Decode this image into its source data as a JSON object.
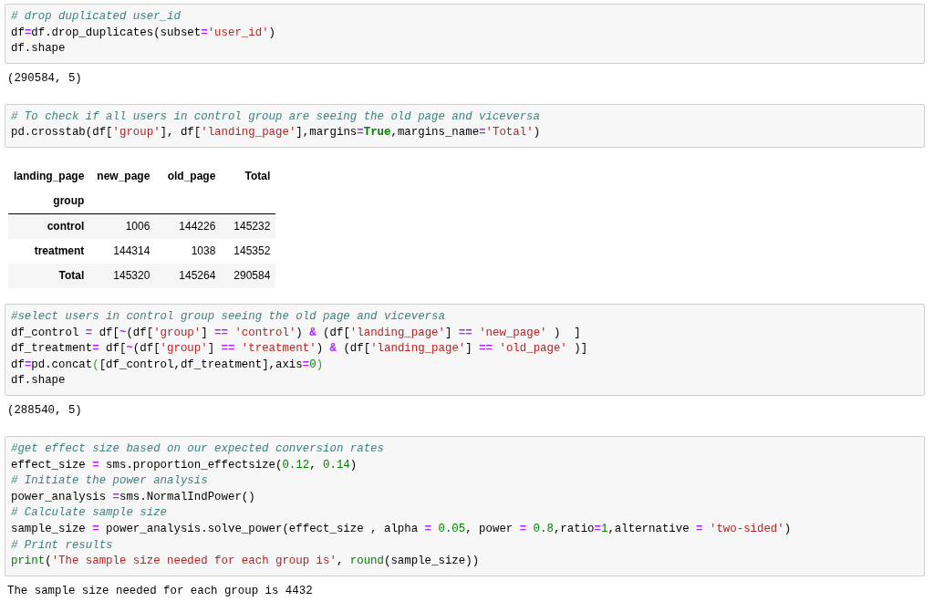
{
  "cells": [
    {
      "input": [
        [
          {
            "kind": "comment",
            "text": "# drop duplicated user_id"
          }
        ],
        [
          {
            "kind": "plain",
            "text": "df"
          },
          {
            "kind": "op",
            "text": "="
          },
          {
            "kind": "plain",
            "text": "df.drop_duplicates(subset"
          },
          {
            "kind": "op",
            "text": "="
          },
          {
            "kind": "string",
            "text": "'user_id'"
          },
          {
            "kind": "plain",
            "text": ")"
          }
        ],
        [
          {
            "kind": "plain",
            "text": "df.shape"
          }
        ]
      ],
      "output": {
        "kind": "text",
        "text": "(290584, 5)"
      }
    },
    {
      "input": [
        [
          {
            "kind": "comment",
            "text": "# To check if all users in control group are seeing the old page and viceversa"
          }
        ],
        [
          {
            "kind": "plain",
            "text": "pd.crosstab(df["
          },
          {
            "kind": "string",
            "text": "'group'"
          },
          {
            "kind": "plain",
            "text": "], df["
          },
          {
            "kind": "string",
            "text": "'landing_page'"
          },
          {
            "kind": "plain",
            "text": "],margins"
          },
          {
            "kind": "op",
            "text": "="
          },
          {
            "kind": "keyword",
            "text": "True"
          },
          {
            "kind": "plain",
            "text": ",margins_name"
          },
          {
            "kind": "op",
            "text": "="
          },
          {
            "kind": "string",
            "text": "'Total'"
          },
          {
            "kind": "plain",
            "text": ")"
          }
        ]
      ],
      "output": {
        "kind": "table",
        "table": {
          "columns_name": "landing_page",
          "index_name": "group",
          "columns": [
            "new_page",
            "old_page",
            "Total"
          ],
          "rows": [
            {
              "index": "control",
              "cells": [
                "1006",
                "144226",
                "145232"
              ]
            },
            {
              "index": "treatment",
              "cells": [
                "144314",
                "1038",
                "145352"
              ]
            },
            {
              "index": "Total",
              "cells": [
                "145320",
                "145264",
                "290584"
              ]
            }
          ]
        }
      }
    },
    {
      "input": [
        [
          {
            "kind": "comment",
            "text": "#select users in control group seeing the old page and viceversa"
          }
        ],
        [
          {
            "kind": "plain",
            "text": "df_control "
          },
          {
            "kind": "op",
            "text": "="
          },
          {
            "kind": "plain",
            "text": " df["
          },
          {
            "kind": "op",
            "text": "~"
          },
          {
            "kind": "plain",
            "text": "(df["
          },
          {
            "kind": "string",
            "text": "'group'"
          },
          {
            "kind": "plain",
            "text": "] "
          },
          {
            "kind": "op",
            "text": "== "
          },
          {
            "kind": "string",
            "text": "'control'"
          },
          {
            "kind": "plain",
            "text": ") "
          },
          {
            "kind": "op",
            "text": "&"
          },
          {
            "kind": "plain",
            "text": " (df["
          },
          {
            "kind": "string",
            "text": "'landing_page'"
          },
          {
            "kind": "plain",
            "text": "] "
          },
          {
            "kind": "op",
            "text": "== "
          },
          {
            "kind": "string",
            "text": "'new_page'"
          },
          {
            "kind": "plain",
            "text": " )  ]"
          }
        ],
        [
          {
            "kind": "plain",
            "text": "df_treatment"
          },
          {
            "kind": "op",
            "text": "="
          },
          {
            "kind": "plain",
            "text": " df["
          },
          {
            "kind": "op",
            "text": "~"
          },
          {
            "kind": "plain",
            "text": "(df["
          },
          {
            "kind": "string",
            "text": "'group'"
          },
          {
            "kind": "plain",
            "text": "] "
          },
          {
            "kind": "op",
            "text": "== "
          },
          {
            "kind": "string",
            "text": "'treatment'"
          },
          {
            "kind": "plain",
            "text": ") "
          },
          {
            "kind": "op",
            "text": "&"
          },
          {
            "kind": "plain",
            "text": " (df["
          },
          {
            "kind": "string",
            "text": "'landing_page'"
          },
          {
            "kind": "plain",
            "text": "] "
          },
          {
            "kind": "op",
            "text": "== "
          },
          {
            "kind": "string",
            "text": "'old_page'"
          },
          {
            "kind": "plain",
            "text": " )]"
          }
        ],
        [
          {
            "kind": "plain",
            "text": "df"
          },
          {
            "kind": "op",
            "text": "="
          },
          {
            "kind": "plain",
            "text": "pd.concat"
          },
          {
            "kind": "bracket",
            "text": "("
          },
          {
            "kind": "plain",
            "text": "[df_control,df_treatment],axis"
          },
          {
            "kind": "op",
            "text": "="
          },
          {
            "kind": "number",
            "text": "0"
          },
          {
            "kind": "bracket",
            "text": ")"
          }
        ],
        [
          {
            "kind": "plain",
            "text": "df.shape"
          }
        ]
      ],
      "output": {
        "kind": "text",
        "text": "(288540, 5)"
      }
    },
    {
      "input": [
        [
          {
            "kind": "comment",
            "text": "#get effect size based on our expected conversion rates"
          }
        ],
        [
          {
            "kind": "plain",
            "text": "effect_size "
          },
          {
            "kind": "op",
            "text": "="
          },
          {
            "kind": "plain",
            "text": " sms.proportion_effectsize("
          },
          {
            "kind": "number",
            "text": "0.12"
          },
          {
            "kind": "plain",
            "text": ", "
          },
          {
            "kind": "number",
            "text": "0.14"
          },
          {
            "kind": "plain",
            "text": ")"
          }
        ],
        [
          {
            "kind": "comment",
            "text": "# Initiate the power analysis"
          }
        ],
        [
          {
            "kind": "plain",
            "text": "power_analysis "
          },
          {
            "kind": "op",
            "text": "="
          },
          {
            "kind": "plain",
            "text": "sms.NormalIndPower()"
          }
        ],
        [
          {
            "kind": "comment",
            "text": "# Calculate sample size"
          }
        ],
        [
          {
            "kind": "plain",
            "text": "sample_size "
          },
          {
            "kind": "op",
            "text": "="
          },
          {
            "kind": "plain",
            "text": " power_analysis.solve_power(effect_size , alpha "
          },
          {
            "kind": "op",
            "text": "= "
          },
          {
            "kind": "number",
            "text": "0.05"
          },
          {
            "kind": "plain",
            "text": ", power "
          },
          {
            "kind": "op",
            "text": "= "
          },
          {
            "kind": "number",
            "text": "0.8"
          },
          {
            "kind": "plain",
            "text": ",ratio"
          },
          {
            "kind": "op",
            "text": "="
          },
          {
            "kind": "number",
            "text": "1"
          },
          {
            "kind": "plain",
            "text": ",alternative "
          },
          {
            "kind": "op",
            "text": "= "
          },
          {
            "kind": "string",
            "text": "'two-sided'"
          },
          {
            "kind": "plain",
            "text": ")"
          }
        ],
        [
          {
            "kind": "comment",
            "text": "# Print results"
          }
        ],
        [
          {
            "kind": "builtin",
            "text": "print"
          },
          {
            "kind": "plain",
            "text": "("
          },
          {
            "kind": "string",
            "text": "'The sample size needed for each group is'"
          },
          {
            "kind": "plain",
            "text": ", "
          },
          {
            "kind": "builtin",
            "text": "round"
          },
          {
            "kind": "plain",
            "text": "(sample_size))"
          }
        ]
      ],
      "output": {
        "kind": "text",
        "text": "The sample size needed for each group is 4432"
      }
    }
  ]
}
